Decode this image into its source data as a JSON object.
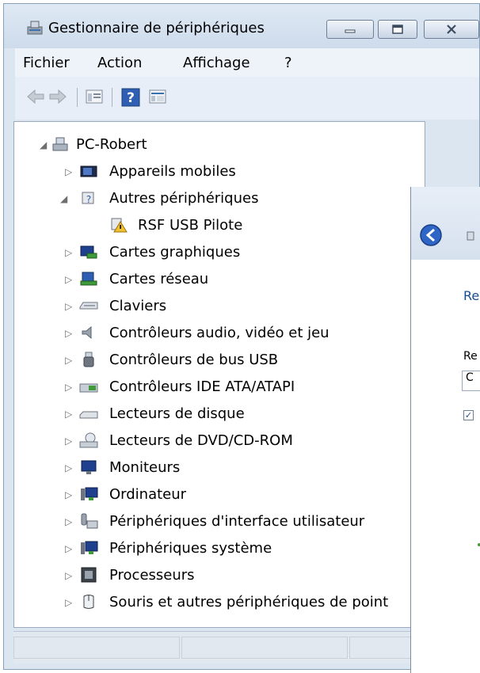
{
  "window": {
    "title": "Gestionnaire de périphériques",
    "icon": "device-manager-icon",
    "controls": [
      "minimize-icon",
      "maximize-icon",
      "close-icon"
    ]
  },
  "menu": [
    "Fichier",
    "Action",
    "Affichage",
    "?"
  ],
  "toolbar": {
    "buttons": [
      "back-arrow-icon",
      "forward-arrow-icon",
      "properties-icon",
      "help-icon",
      "view-details-icon"
    ]
  },
  "tree": {
    "root": "PC-Robert",
    "items": [
      {
        "label": "Appareils mobiles",
        "icon": "mobile-device-icon",
        "expanded": false
      },
      {
        "label": "Autres périphériques",
        "icon": "unknown-device-icon",
        "expanded": true
      },
      {
        "label": "RSF USB Pilote",
        "icon": "warning-device-icon",
        "child": true
      },
      {
        "label": "Cartes graphiques",
        "icon": "display-adapter-icon",
        "expanded": false
      },
      {
        "label": "Cartes réseau",
        "icon": "network-adapter-icon",
        "expanded": false
      },
      {
        "label": "Claviers",
        "icon": "keyboard-icon",
        "expanded": false
      },
      {
        "label": "Contrôleurs audio, vidéo et jeu",
        "icon": "speaker-icon",
        "expanded": false
      },
      {
        "label": "Contrôleurs de bus USB",
        "icon": "usb-icon",
        "expanded": false
      },
      {
        "label": "Contrôleurs IDE ATA/ATAPI",
        "icon": "ide-controller-icon",
        "expanded": false
      },
      {
        "label": "Lecteurs de disque",
        "icon": "disk-drive-icon",
        "expanded": false
      },
      {
        "label": "Lecteurs de DVD/CD-ROM",
        "icon": "dvd-drive-icon",
        "expanded": false
      },
      {
        "label": "Moniteurs",
        "icon": "monitor-icon",
        "expanded": false
      },
      {
        "label": "Ordinateur",
        "icon": "computer-icon",
        "expanded": false
      },
      {
        "label": "Périphériques d'interface utilisateur",
        "icon": "hid-icon",
        "expanded": false
      },
      {
        "label": "Périphériques système",
        "icon": "system-device-icon",
        "expanded": false
      },
      {
        "label": "Processeurs",
        "icon": "processor-icon",
        "expanded": false
      },
      {
        "label": "Souris et autres périphériques de point",
        "icon": "mouse-icon",
        "expanded": false
      }
    ]
  },
  "dialog": {
    "heading": "Re",
    "label": "Re",
    "field_value": "C",
    "checkbox_checked": true,
    "colors": {
      "heading": "#1a4d8c",
      "accent": "#4a9a3a"
    }
  }
}
